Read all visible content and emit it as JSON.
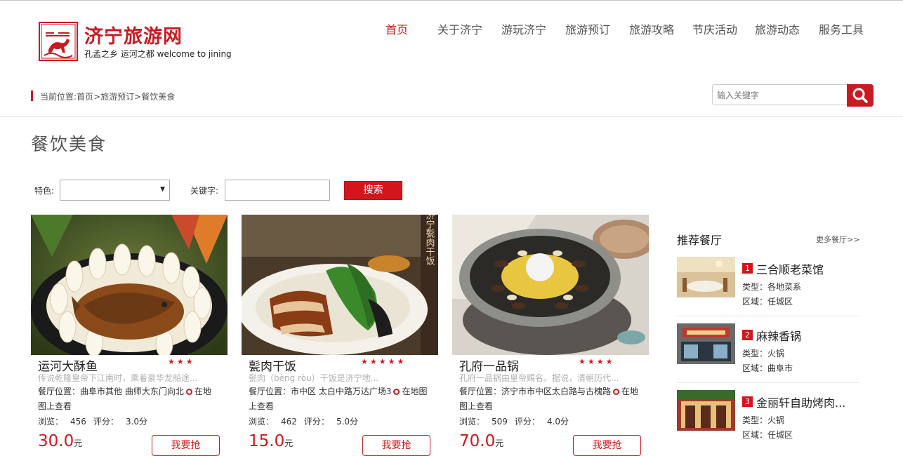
{
  "header": {
    "logo_title": "济宁旅游网",
    "logo_subtitle": "孔孟之乡 运河之都 welcome to jining",
    "nav": [
      {
        "label": "首页",
        "active": true
      },
      {
        "label": "关于济宁"
      },
      {
        "label": "游玩济宁"
      },
      {
        "label": "旅游预订"
      },
      {
        "label": "旅游攻略"
      },
      {
        "label": "节庆活动"
      },
      {
        "label": "旅游动态"
      },
      {
        "label": "服务工具"
      }
    ]
  },
  "breadcrumb": {
    "prefix": "当前位置:",
    "items": [
      "首页",
      ">",
      "旅游预订",
      ">",
      "餐饮美食"
    ]
  },
  "search": {
    "placeholder": "输入关键字"
  },
  "page": {
    "title": "餐饮美食"
  },
  "filters": {
    "feature_label": "特色:",
    "feature_value": "",
    "keyword_label": "关键字:",
    "keyword_value": "",
    "search_button": "搜索"
  },
  "cards": [
    {
      "name": "运河大酥鱼",
      "stars": 3,
      "desc": "传说乾隆皇帝下江南时，乘着豪华龙船途...",
      "addr_line1": "餐厅位置：曲阜市其他 曲师大东门向北",
      "map_label": "在地",
      "addr_line2": "图上查看",
      "views_label": "浏览：",
      "views": "456",
      "score_label": "评分：",
      "score": "3.0分",
      "price": "30.0",
      "currency": "元",
      "button": "我要抢"
    },
    {
      "name": "甏肉干饭",
      "stars": 5,
      "desc": "甏肉（bèng ròu）干饭是济宁地...",
      "addr_line1": "餐厅位置：市中区 太白中路万达广场3",
      "map_label": "在地图",
      "addr_line2": "上查看",
      "views_label": "浏览：",
      "views": "462",
      "score_label": "评分：",
      "score": "5.0分",
      "price": "15.0",
      "currency": "元",
      "button": "我要抢"
    },
    {
      "name": "孔府一品锅",
      "stars": 4,
      "desc": "孔府一品锅由皇帝赐名。据说，清朝历代...",
      "addr_line1": "餐厅位置：济宁市市中区太白路与古槐路",
      "map_label": "在地",
      "addr_line2": "图上查看",
      "views_label": "浏览：",
      "views": "509",
      "score_label": "评分：",
      "score": "4.0分",
      "price": "70.0",
      "currency": "元",
      "button": "我要抢"
    }
  ],
  "sidebar": {
    "title": "推荐餐厅",
    "more": "更多餐厅>>",
    "items": [
      {
        "rank": "1",
        "name": "三合顺老菜馆",
        "type": "类型：各地菜系",
        "area": "区域：任城区"
      },
      {
        "rank": "2",
        "name": "麻辣香锅",
        "type": "类型：火锅",
        "area": "区域：曲阜市"
      },
      {
        "rank": "3",
        "name": "金丽轩自助烤肉...",
        "type": "类型：火锅",
        "area": "区域：任城区"
      }
    ]
  },
  "colors": {
    "brand_red": "#c91a22",
    "button_red": "#d4161c"
  }
}
